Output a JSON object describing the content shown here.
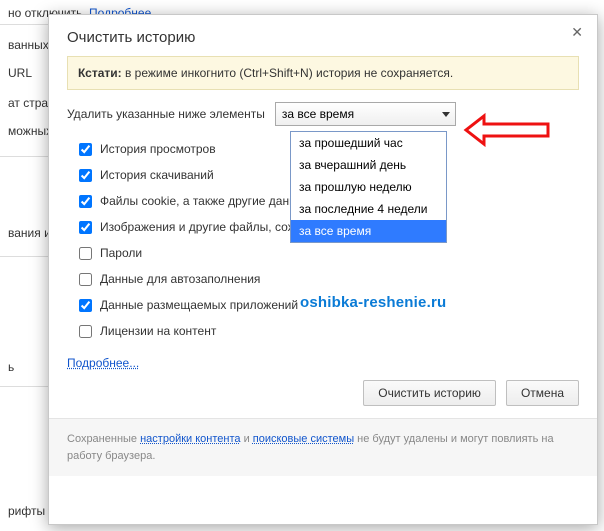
{
  "bg": {
    "line0a": "но отключить. ",
    "line0b": "Подробнее...",
    "line1": "ванных",
    "line2": "URL",
    "line3": "ат страни",
    "line4": "можных",
    "line5": "вания и",
    "line6": "ь",
    "line7": "рифты"
  },
  "dialog": {
    "title": "Очистить историю",
    "close": "✕",
    "notice_b": "Кстати:",
    "notice_rest": " в режиме инкогнито (Ctrl+Shift+N) история не сохраняется.",
    "delete_label": "Удалить указанные ниже элементы",
    "select_value": "за все время",
    "options": [
      "за прошедший час",
      "за вчерашний день",
      "за прошлую неделю",
      "за последние 4 недели",
      "за все время"
    ],
    "checks": [
      {
        "label": "История просмотров",
        "checked": true
      },
      {
        "label": "История скачиваний",
        "checked": true
      },
      {
        "label": "Файлы cookie, а также другие данные",
        "checked": true
      },
      {
        "label": "Изображения и другие файлы, сохраненные в кеше",
        "checked": true
      },
      {
        "label": "Пароли",
        "checked": false
      },
      {
        "label": "Данные для автозаполнения",
        "checked": false
      },
      {
        "label": "Данные размещаемых приложений",
        "checked": true
      },
      {
        "label": "Лицензии на контент",
        "checked": false
      }
    ],
    "more": "Подробнее...",
    "btn_clear": "Очистить историю",
    "btn_cancel": "Отмена",
    "footer_a": "Сохраненные ",
    "footer_l1": "настройки контента",
    "footer_b": " и ",
    "footer_l2": "поисковые системы",
    "footer_c": " не будут удалены и могут повлиять на работу браузера."
  },
  "watermark": "oshibka-reshenie.ru"
}
